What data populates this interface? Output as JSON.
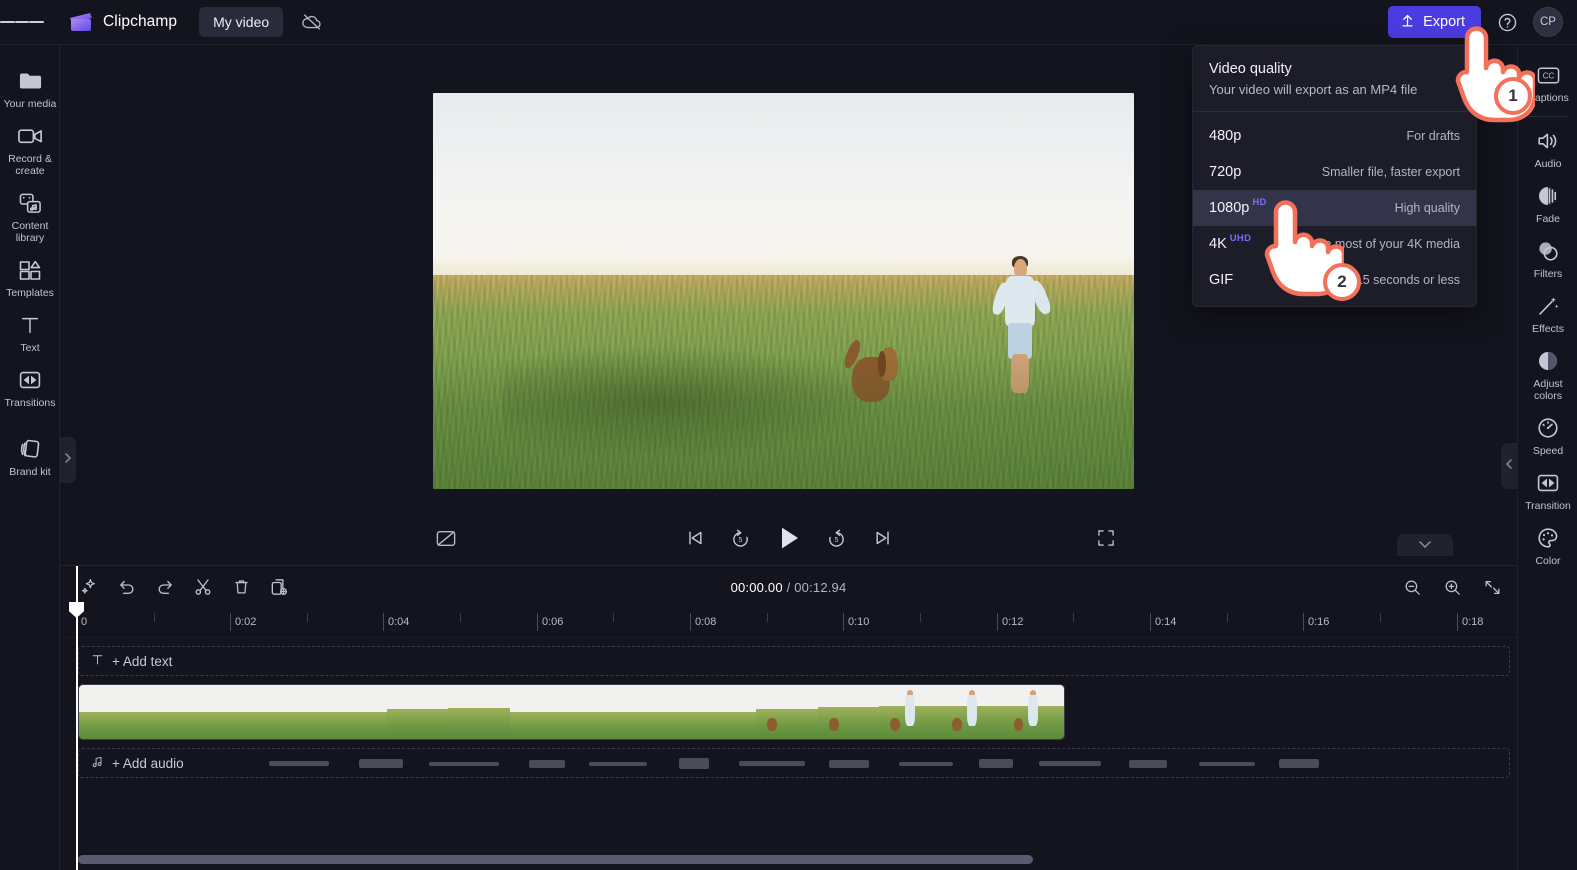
{
  "app": {
    "brand": "Clipchamp",
    "project_name": "My video",
    "sync_icon": "cloud-off-icon",
    "menu_icon": "hamburger-menu-icon"
  },
  "topbar": {
    "export_label": "Export",
    "export_icon": "upload-arrow-icon",
    "export_color": "#4b3ce0",
    "help_icon": "help-circle-icon",
    "avatar_initials": "CP"
  },
  "left_rail": {
    "items": [
      {
        "label": "Your media",
        "icon": "media-folder-icon"
      },
      {
        "label": "Record &\ncreate",
        "label_line1": "Record &",
        "label_line2": "create",
        "icon": "video-camera-icon"
      },
      {
        "label": "Content\nlibrary",
        "label_line1": "Content",
        "label_line2": "library",
        "icon": "content-library-icon"
      },
      {
        "label": "Templates",
        "icon": "templates-icon"
      },
      {
        "label": "Text",
        "icon": "text-t-icon"
      },
      {
        "label": "Transitions",
        "icon": "transitions-icon"
      },
      {
        "label": "Brand kit",
        "icon": "brand-kit-icon"
      }
    ],
    "collapse_icon": "chevron-right-icon"
  },
  "right_rail": {
    "items": [
      {
        "label": "Captions",
        "icon": "cc-captions-icon"
      },
      {
        "label": "Audio",
        "icon": "speaker-icon"
      },
      {
        "label": "Fade",
        "icon": "fade-icon"
      },
      {
        "label": "Filters",
        "icon": "filters-circles-icon"
      },
      {
        "label": "Effects",
        "icon": "magic-wand-icon"
      },
      {
        "label": "Adjust\ncolors",
        "label_line1": "Adjust",
        "label_line2": "colors",
        "icon": "contrast-circle-icon"
      },
      {
        "label": "Speed",
        "icon": "speedometer-icon"
      },
      {
        "label": "Transition",
        "icon": "transition-icon"
      },
      {
        "label": "Color",
        "icon": "color-palette-icon"
      }
    ],
    "collapse_icon": "chevron-left-icon"
  },
  "preview": {
    "description": "Video preview: a boy in a light blue shirt running through a tall grassy field with a brown dog",
    "controls": [
      {
        "name": "hide-captions-button",
        "icon": "captions-off-icon"
      },
      {
        "name": "skip-to-start-button",
        "icon": "skip-previous-icon"
      },
      {
        "name": "rewind-5s-button",
        "icon": "replay-5-icon",
        "value": "5"
      },
      {
        "name": "play-button",
        "icon": "play-triangle-icon"
      },
      {
        "name": "forward-5s-button",
        "icon": "forward-5-icon",
        "value": "5"
      },
      {
        "name": "skip-to-end-button",
        "icon": "skip-next-icon"
      },
      {
        "name": "fullscreen-button",
        "icon": "fullscreen-icon"
      }
    ],
    "collapse_down_icon": "chevron-down-icon"
  },
  "timeline": {
    "tools": [
      {
        "name": "magic-suggestions-button",
        "icon": "sparkle-icon"
      },
      {
        "name": "undo-button",
        "icon": "undo-arrow-icon"
      },
      {
        "name": "redo-button",
        "icon": "redo-arrow-icon"
      },
      {
        "name": "split-button",
        "icon": "scissors-icon"
      },
      {
        "name": "delete-button",
        "icon": "trash-icon"
      },
      {
        "name": "duplicate-button",
        "icon": "duplicate-icon"
      }
    ],
    "current_time": "00:00.00",
    "time_separator": " / ",
    "total_time": "00:12.94",
    "zoom_controls": [
      {
        "name": "zoom-out-button",
        "icon": "zoom-out-icon"
      },
      {
        "name": "zoom-in-button",
        "icon": "zoom-in-icon"
      },
      {
        "name": "fit-to-timeline-button",
        "icon": "fit-arrows-icon"
      }
    ],
    "ruler_labels": [
      "0",
      "0:02",
      "0:04",
      "0:06",
      "0:08",
      "0:10",
      "0:12",
      "0:14",
      "0:16",
      "0:18"
    ],
    "add_text_label": "+ Add text",
    "add_text_icon": "text-t-icon",
    "add_audio_label": "+ Add audio",
    "add_audio_icon": "music-note-icon",
    "playhead_position": "0"
  },
  "export_dropdown": {
    "title": "Video quality",
    "subtitle": "Your video will export as an MP4 file",
    "options": [
      {
        "resolution": "480p",
        "badge": "",
        "description": "For drafts",
        "selected": false
      },
      {
        "resolution": "720p",
        "badge": "",
        "description": "Smaller file, faster export",
        "selected": false
      },
      {
        "resolution": "1080p",
        "badge": "HD",
        "description": "High quality",
        "selected": true
      },
      {
        "resolution": "4K",
        "badge": "UHD",
        "description": "Make the most of your 4K media",
        "selected": false
      },
      {
        "resolution": "GIF",
        "badge": "",
        "description": "For videos 15 seconds or less",
        "selected": false
      }
    ],
    "badge_color": "#7a6bff",
    "selected_row_color": "#33334a"
  },
  "annotations": {
    "step_color": "#f4705a",
    "steps": [
      {
        "number": "1",
        "target": "export-button"
      },
      {
        "number": "2",
        "target": "1080p-option"
      }
    ]
  }
}
